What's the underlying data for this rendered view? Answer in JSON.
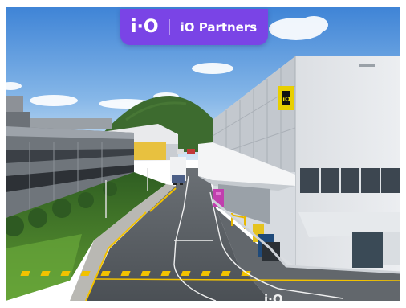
{
  "brand": {
    "logo": "i·O",
    "name": "iO Partners"
  },
  "building": {
    "sign": "iO"
  },
  "colors": {
    "badge": "#7a44e6",
    "sky_top": "#3f84d6",
    "sky_bottom": "#cfe3f6",
    "hill": "#3d6b2f",
    "facade": "#e3e6ea",
    "road": "#555a5f",
    "road_marking": "#f2c200",
    "grass": "#4f8b2f"
  }
}
